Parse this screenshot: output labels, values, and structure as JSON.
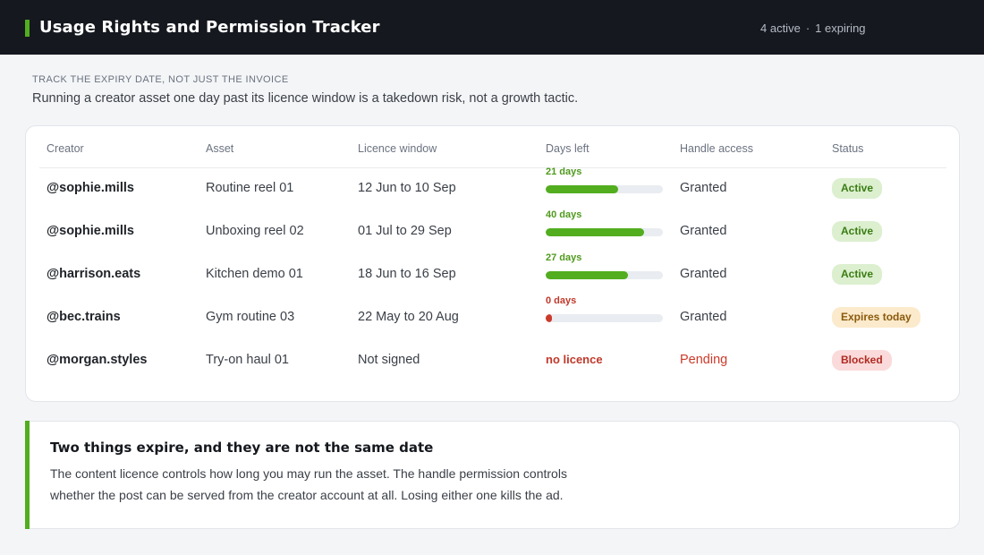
{
  "header": {
    "title": "Usage Rights and Permission Tracker",
    "active_count": "4 active",
    "separator": "·",
    "expiring_count": "1 expiring",
    "accent_color": "#52ad1f"
  },
  "intro": {
    "eyebrow": "TRACK THE EXPIRY DATE, NOT JUST THE INVOICE",
    "lede": "Running a creator asset one day past its licence window is a takedown risk, not a growth tactic."
  },
  "table": {
    "columns": [
      "Creator",
      "Asset",
      "Licence window",
      "Days left",
      "Handle access",
      "Status"
    ],
    "rows": [
      {
        "creator": "@sophie.mills",
        "asset": "Routine reel 01",
        "window": "12 Jun to 10 Sep",
        "days_label": "21 days",
        "days_fraction": 0.62,
        "handle": "Granted",
        "status": "Active",
        "status_kind": "active"
      },
      {
        "creator": "@sophie.mills",
        "asset": "Unboxing reel 02",
        "window": "01 Jul to 29 Sep",
        "days_label": "40 days",
        "days_fraction": 0.84,
        "handle": "Granted",
        "status": "Active",
        "status_kind": "active"
      },
      {
        "creator": "@harrison.eats",
        "asset": "Kitchen demo 01",
        "window": "18 Jun to 16 Sep",
        "days_label": "27 days",
        "days_fraction": 0.7,
        "handle": "Granted",
        "status": "Active",
        "status_kind": "active"
      },
      {
        "creator": "@bec.trains",
        "asset": "Gym routine 03",
        "window": "22 May to 20 Aug",
        "days_label": "0 days",
        "days_fraction": 0.05,
        "handle": "Granted",
        "status": "Expires today",
        "status_kind": "expiring"
      },
      {
        "creator": "@morgan.styles",
        "asset": "Try-on haul 01",
        "window": "Not signed",
        "days_label": "no licence",
        "days_fraction": null,
        "handle": "Pending",
        "status": "Blocked",
        "status_kind": "blocked"
      }
    ]
  },
  "note": {
    "title": "Two things expire, and they are not the same date",
    "body": "The content licence controls how long you may run the asset. The handle permission controls whether the post can be served from the creator account at all. Losing either one kills the ad."
  }
}
